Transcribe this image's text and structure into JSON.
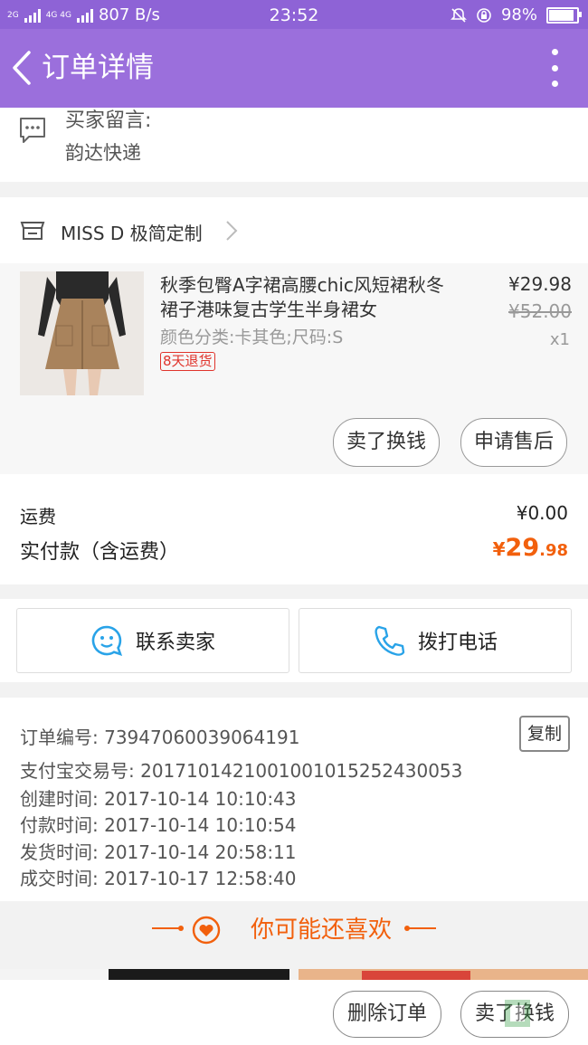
{
  "status_bar": {
    "network": "2G",
    "network2": "4G 4G",
    "speed": "807 B/s",
    "time": "23:52",
    "battery": "98%"
  },
  "header": {
    "title": "订单详情"
  },
  "buyer_note": {
    "label": "买家留言:",
    "value": "韵达快递"
  },
  "shop": {
    "name": "MISS D 极简定制"
  },
  "item": {
    "title": "秋季包臀A字裙高腰chic风短裙秋冬裙子港味复古学生半身裙女",
    "attributes": "颜色分类:卡其色;尺码:S",
    "badge": "8天退货",
    "price": "¥29.98",
    "original_price": "¥52.00",
    "quantity": "x1",
    "btn_resell": "卖了换钱",
    "btn_after_sale": "申请售后"
  },
  "payment": {
    "freight_label": "运费",
    "freight_value": "¥0.00",
    "total_label": "实付款（含运费）",
    "total_currency": "¥",
    "total_main": "29",
    "total_decimal": ".98"
  },
  "contact": {
    "seller_label": "联系卖家",
    "call_label": "拨打电话"
  },
  "order_info": {
    "order_no": "订单编号: 73947060039064191",
    "copy_label": "复制",
    "alipay_no": "支付宝交易号: 2017101421001001015252430053",
    "created": "创建时间: 2017-10-14 10:10:43",
    "paid": "付款时间: 2017-10-14 10:10:54",
    "shipped": "发货时间: 2017-10-14 20:58:11",
    "completed": "成交时间: 2017-10-17 12:58:40"
  },
  "recommend": {
    "title": "你可能还喜欢"
  },
  "bottom": {
    "delete_label": "删除订单",
    "resell_label": "卖了换钱"
  },
  "colors": {
    "header": "#9b6fdc",
    "accent": "#f2600d",
    "badge": "#e0342c",
    "icon_blue": "#29a3e8"
  }
}
